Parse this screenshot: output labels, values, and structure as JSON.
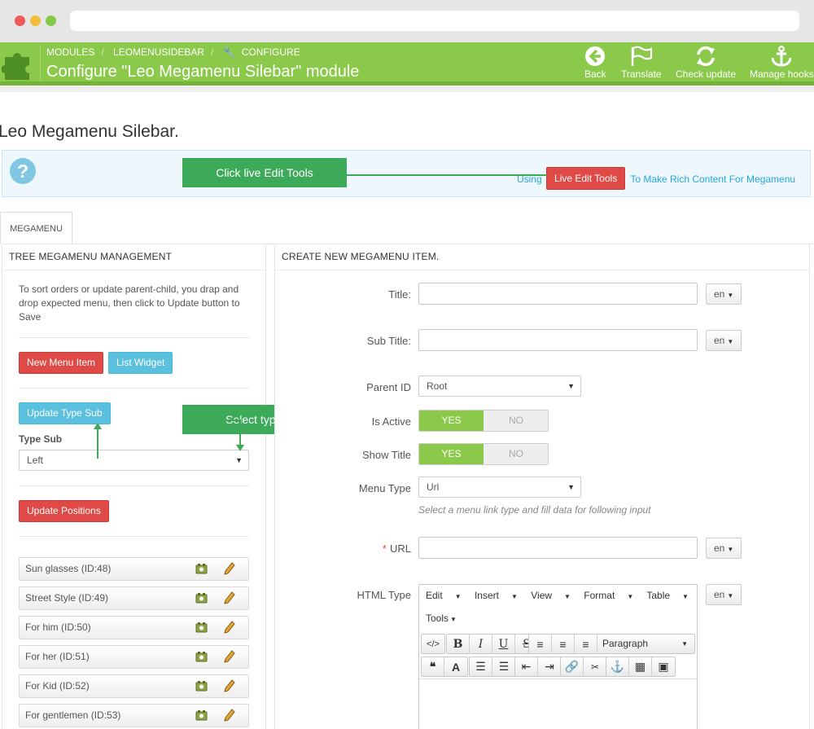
{
  "header": {
    "breadcrumb": [
      "MODULES",
      "LEOMENUSIDEBAR",
      "CONFIGURE"
    ],
    "title": "Configure \"Leo Megamenu Silebar\" module",
    "toolbar": [
      {
        "label": "Back",
        "icon": "back-arrow-icon"
      },
      {
        "label": "Translate",
        "icon": "flag-icon"
      },
      {
        "label": "Check update",
        "icon": "refresh-icon"
      },
      {
        "label": "Manage hooks",
        "icon": "anchor-icon"
      }
    ],
    "accent": "#8bc94a"
  },
  "module_title": "Leo Megamenu Silebar.",
  "help": {
    "prefix": "Using",
    "button": "Live Edit Tools",
    "suffix": "To Make Rich Content For Megamenu"
  },
  "callouts": {
    "live_edit": "Click live Edit Tools",
    "type_sub": "Select type sub"
  },
  "tab": "MEGAMENU",
  "left_panel": {
    "heading": "TREE MEGAMENU MANAGEMENT",
    "description": "To sort orders or update parent-child, you drap and drop expected menu, then click to Update button to Save",
    "new_menu_item": "New Menu Item",
    "list_widget": "List Widget",
    "update_type_sub": "Update Type Sub",
    "type_sub_label": "Type Sub",
    "type_sub_value": "Left",
    "update_positions": "Update Positions",
    "menu_items": [
      "Sun glasses (ID:48)",
      "Street Style (ID:49)",
      "For him (ID:50)",
      "For her (ID:51)",
      "For Kid (ID:52)",
      "For gentlemen (ID:53)"
    ]
  },
  "right_panel": {
    "heading": "CREATE NEW MEGAMENU ITEM.",
    "title_label": "Title:",
    "subtitle_label": "Sub Title:",
    "parent_label": "Parent ID",
    "parent_value": "Root",
    "active_label": "Is Active",
    "show_title_label": "Show Title",
    "yes": "YES",
    "no": "NO",
    "menu_type_label": "Menu Type",
    "menu_type_value": "Url",
    "menu_type_hint": "Select a menu link type and fill data for following input",
    "url_required": "*",
    "url_label": "URL",
    "html_type_label": "HTML Type",
    "lang": "en",
    "editor": {
      "menus": [
        "Edit",
        "Insert",
        "View",
        "Format",
        "Table"
      ],
      "tools": "Tools",
      "paragraph": "Paragraph"
    }
  }
}
